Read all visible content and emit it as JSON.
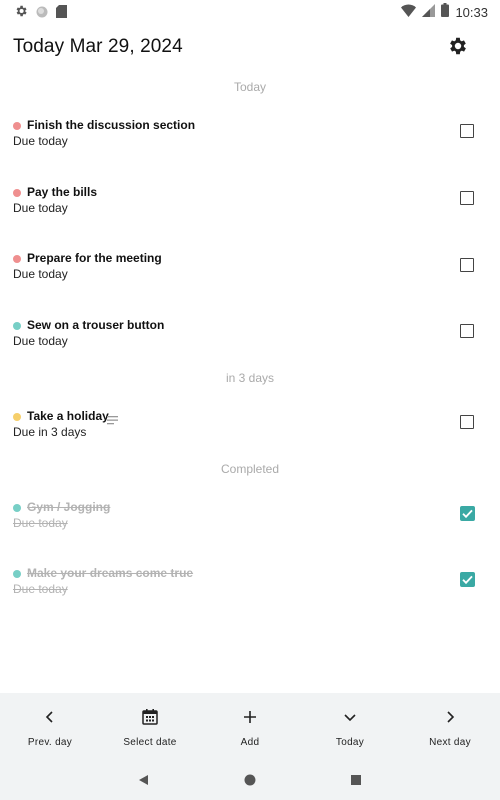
{
  "status_bar": {
    "time": "10:33",
    "left_icons": [
      "gear-icon",
      "circle-icon",
      "sd-card-icon"
    ],
    "right_icons": [
      "wifi-icon",
      "signal-icon",
      "battery-icon"
    ]
  },
  "header": {
    "title": "Today Mar 29, 2024",
    "settings_icon": "gear-icon"
  },
  "sections": {
    "today": "Today",
    "in_three_days": "in 3 days",
    "completed": "Completed"
  },
  "tasks": [
    {
      "title": "Finish the discussion section",
      "due": "Due today",
      "color": "#ef8f8f",
      "checked": false
    },
    {
      "title": "Pay the bills",
      "due": "Due today",
      "color": "#ef8f8f",
      "checked": false
    },
    {
      "title": "Prepare for the meeting",
      "due": "Due today",
      "color": "#ef8f8f",
      "checked": false
    },
    {
      "title": "Sew on a trouser button",
      "due": "Due today",
      "color": "#77cfc6",
      "checked": false
    },
    {
      "title": "Take a holiday",
      "due": "Due in 3 days",
      "color": "#f6cf6b",
      "checked": false,
      "has_note": true
    },
    {
      "title": "Gym / Jogging",
      "due": "Due today",
      "color": "#77cfc6",
      "checked": true
    },
    {
      "title": "Make your dreams come true",
      "due": "Due today",
      "color": "#77cfc6",
      "checked": true
    }
  ],
  "bottom_nav": [
    {
      "label": "Prev. day",
      "icon": "chevron-left-icon"
    },
    {
      "label": "Select date",
      "icon": "calendar-icon"
    },
    {
      "label": "Add",
      "icon": "plus-icon"
    },
    {
      "label": "Today",
      "icon": "chevron-down-icon"
    },
    {
      "label": "Next day",
      "icon": "chevron-right-icon"
    }
  ],
  "system_nav": [
    "back-icon",
    "home-icon",
    "recents-icon"
  ],
  "colors": {
    "accent": "#3aa9a4",
    "red_dot": "#ef8f8f",
    "teal_dot": "#77cfc6",
    "yellow_dot": "#f6cf6b",
    "nav_background": "#f1f3f4"
  }
}
